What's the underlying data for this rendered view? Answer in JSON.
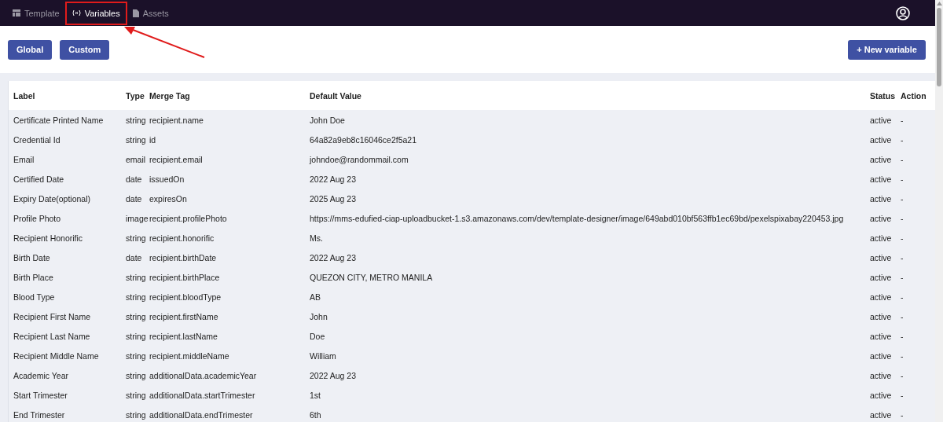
{
  "nav": {
    "tabs": [
      {
        "label": "Template",
        "selected": false
      },
      {
        "label": "Variables",
        "selected": true
      },
      {
        "label": "Assets",
        "selected": false
      }
    ]
  },
  "scope_buttons": [
    {
      "label": "Global"
    },
    {
      "label": "Custom"
    }
  ],
  "new_button": {
    "label": "+ New variable"
  },
  "table": {
    "columns": [
      "Label",
      "Type",
      "Merge Tag",
      "Default Value",
      "Status",
      "Action"
    ],
    "rows": [
      [
        "Certificate Printed Name",
        "string",
        "recipient.name",
        "John Doe",
        "active",
        "-"
      ],
      [
        "Credential Id",
        "string",
        "id",
        "64a82a9eb8c16046ce2f5a21",
        "active",
        "-"
      ],
      [
        "Email",
        "email",
        "recipient.email",
        "johndoe@randommail.com",
        "active",
        "-"
      ],
      [
        "Certified Date",
        "date",
        "issuedOn",
        "2022 Aug 23",
        "active",
        "-"
      ],
      [
        "Expiry Date(optional)",
        "date",
        "expiresOn",
        "2025 Aug 23",
        "active",
        "-"
      ],
      [
        "Profile Photo",
        "image",
        "recipient.profilePhoto",
        "https://mms-edufied-ciap-uploadbucket-1.s3.amazonaws.com/dev/template-designer/image/649abd010bf563ffb1ec69bd/pexelspixabay220453.jpg",
        "active",
        "-"
      ],
      [
        "Recipient Honorific",
        "string",
        "recipient.honorific",
        "Ms.",
        "active",
        "-"
      ],
      [
        "Birth Date",
        "date",
        "recipient.birthDate",
        "2022 Aug 23",
        "active",
        "-"
      ],
      [
        "Birth Place",
        "string",
        "recipient.birthPlace",
        "QUEZON CITY, METRO MANILA",
        "active",
        "-"
      ],
      [
        "Blood Type",
        "string",
        "recipient.bloodType",
        "AB",
        "active",
        "-"
      ],
      [
        "Recipient First Name",
        "string",
        "recipient.firstName",
        "John",
        "active",
        "-"
      ],
      [
        "Recipient Last Name",
        "string",
        "recipient.lastName",
        "Doe",
        "active",
        "-"
      ],
      [
        "Recipient Middle Name",
        "string",
        "recipient.middleName",
        "William",
        "active",
        "-"
      ],
      [
        "Academic Year",
        "string",
        "additionalData.academicYear",
        "2022 Aug 23",
        "active",
        "-"
      ],
      [
        "Start Trimester",
        "string",
        "additionalData.startTrimester",
        "1st",
        "active",
        "-"
      ],
      [
        "End Trimester",
        "string",
        "additionalData.endTrimester",
        "6th",
        "active",
        "-"
      ]
    ]
  }
}
